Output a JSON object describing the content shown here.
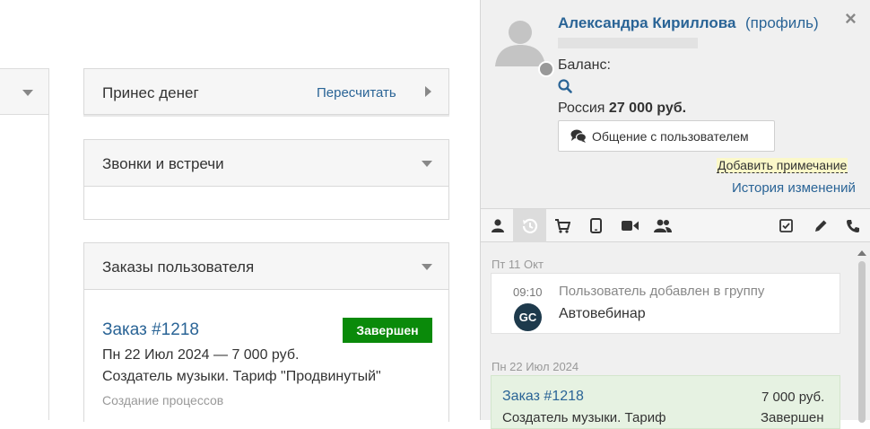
{
  "left": {
    "money_panel": {
      "title": "Принес денег",
      "action": "Пересчитать"
    },
    "calls_panel": {
      "title": "Звонки и встречи"
    },
    "orders_panel": {
      "title": "Заказы пользователя",
      "order": {
        "number": "Заказ #1218",
        "status": "Завершен",
        "date_sum": "Пн 22 Июл 2024 — 7 000 руб.",
        "product": "Создатель музыки. Тариф \"Продвинутый\"",
        "category": "Создание процессов"
      }
    }
  },
  "sidebar": {
    "user_name": "Александра Кириллова",
    "profile_link": "(профиль)",
    "balance_label": "Баланс:",
    "country_prefix": "Россия",
    "country_sum": "27 000 руб.",
    "chat_button": "Общение с пользователем",
    "add_note": "Добавить примечание",
    "history": "История изменений",
    "close": "×",
    "feed": {
      "day1": "Пт 11 Окт",
      "event_time": "09:10",
      "event_text": "Пользователь добавлен в группу",
      "event_group": "Автовебинар",
      "logo_text": "GC",
      "day2": "Пн 22 Июл 2024",
      "order_number": "Заказ #1218",
      "order_sum": "7 000 руб.",
      "order_product": "Создатель музыки. Тариф",
      "order_status": "Завершен"
    }
  },
  "colors": {
    "link": "#2a6496",
    "success": "#0a8a0a",
    "arrow": "#e53935",
    "highlight": "#fbf8c9",
    "order_card": "#e6f2e2"
  }
}
